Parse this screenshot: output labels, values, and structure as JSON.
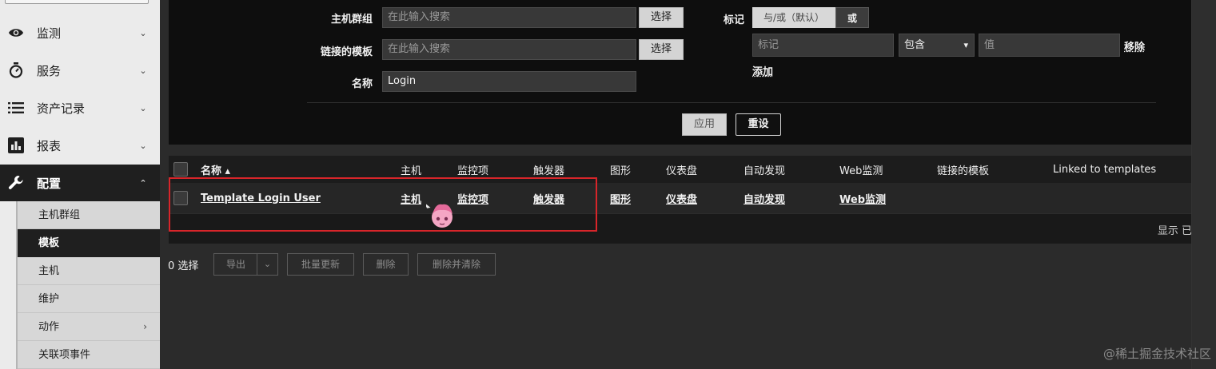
{
  "sidebar": {
    "items": [
      {
        "label": "监测",
        "icon": "eye-icon"
      },
      {
        "label": "服务",
        "icon": "stopwatch-icon"
      },
      {
        "label": "资产记录",
        "icon": "list-icon"
      },
      {
        "label": "报表",
        "icon": "bar-chart-icon"
      },
      {
        "label": "配置",
        "icon": "wrench-icon"
      }
    ],
    "submenu": [
      {
        "label": "主机群组"
      },
      {
        "label": "模板"
      },
      {
        "label": "主机"
      },
      {
        "label": "维护"
      },
      {
        "label": "动作"
      },
      {
        "label": "关联项事件"
      }
    ]
  },
  "filter": {
    "host_group_label": "主机群组",
    "host_group_placeholder": "在此输入搜索",
    "linked_template_label": "链接的模板",
    "linked_template_placeholder": "在此输入搜索",
    "select_label": "选择",
    "name_label": "名称",
    "name_value": "Login",
    "tags_label": "标记",
    "and_or_label": "与/或（默认）",
    "or_label": "或",
    "tag_placeholder": "标记",
    "operator_value": "包含",
    "value_placeholder": "值",
    "remove_label": "移除",
    "add_label": "添加",
    "apply_label": "应用",
    "reset_label": "重设"
  },
  "table": {
    "headers": {
      "name": "名称 ▴",
      "hosts": "主机",
      "items": "监控项",
      "triggers": "触发器",
      "graphs": "图形",
      "dashboards": "仪表盘",
      "discovery": "自动发现",
      "web": "Web监测",
      "linked_templates": "链接的模板",
      "linked_to_templates": "Linked to templates"
    },
    "rows": [
      {
        "name": "Template Login User",
        "hosts": "主机",
        "items": "监控项",
        "triggers": "触发器",
        "graphs": "图形",
        "dashboards": "仪表盘",
        "discovery": "自动发现",
        "web": "Web监测"
      }
    ],
    "display_text": "显示 已"
  },
  "actions": {
    "selected_count": "0 选择",
    "export_label": "导出",
    "mass_update_label": "批量更新",
    "delete_label": "删除",
    "delete_clear_label": "删除并清除"
  },
  "watermark": "@稀土掘金技术社区",
  "colors": {
    "highlight_border": "#d8252a",
    "sidebar_bg": "#ebebeb",
    "panel_bg": "#0e0e0e"
  }
}
